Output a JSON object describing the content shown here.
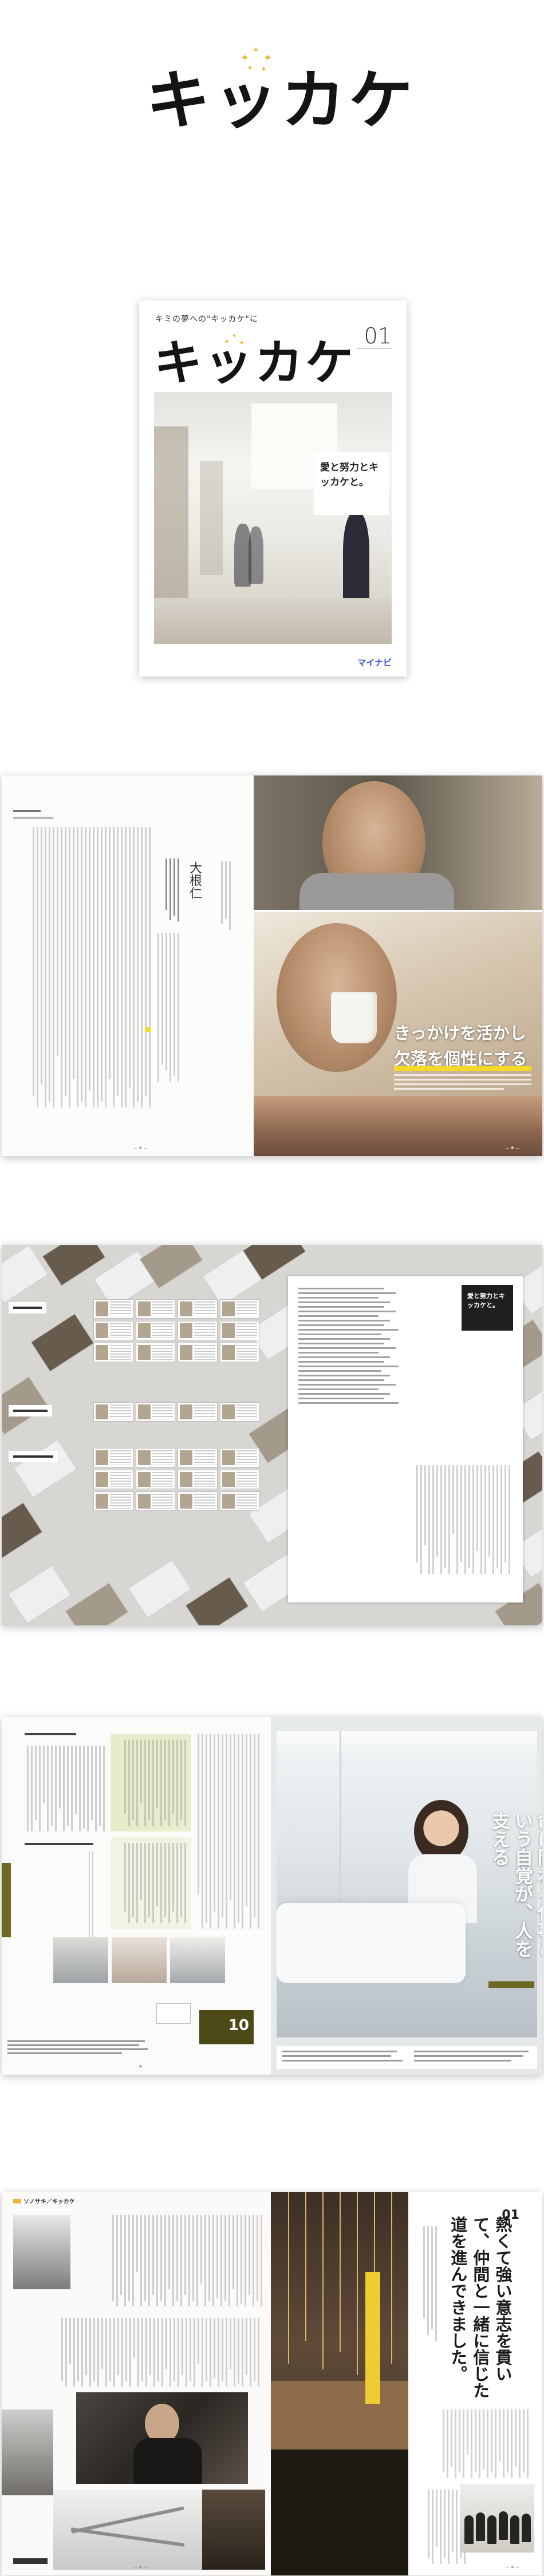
{
  "logo": {
    "text": "キッカケ",
    "sparkle_color": "#e8b830"
  },
  "cover": {
    "tagline": "キミの夢への\"キッカケ\"に",
    "title": "キッカケ",
    "issue": "01",
    "lead": "愛と努力とキッカケと。",
    "brand": "マイナビ"
  },
  "spread1": {
    "headline_line1": "きっかけを活かし",
    "headline_line2": "欠落を個性にする",
    "name": "大根仁",
    "accent_color": "#f4d928"
  },
  "spread2": {
    "box_text": "愛と努力とキッカケと。"
  },
  "spread3": {
    "headline": "命に関わる仕事という自覚が、人を支える",
    "badge": "10",
    "accent_color": "#6c6a22"
  },
  "spread4": {
    "section_tag": "ソノサキ／キッカケ",
    "number": "01",
    "headline": "熱くて強い意志を貫いて、仲間と一緒に信じた道を進んできました。"
  }
}
